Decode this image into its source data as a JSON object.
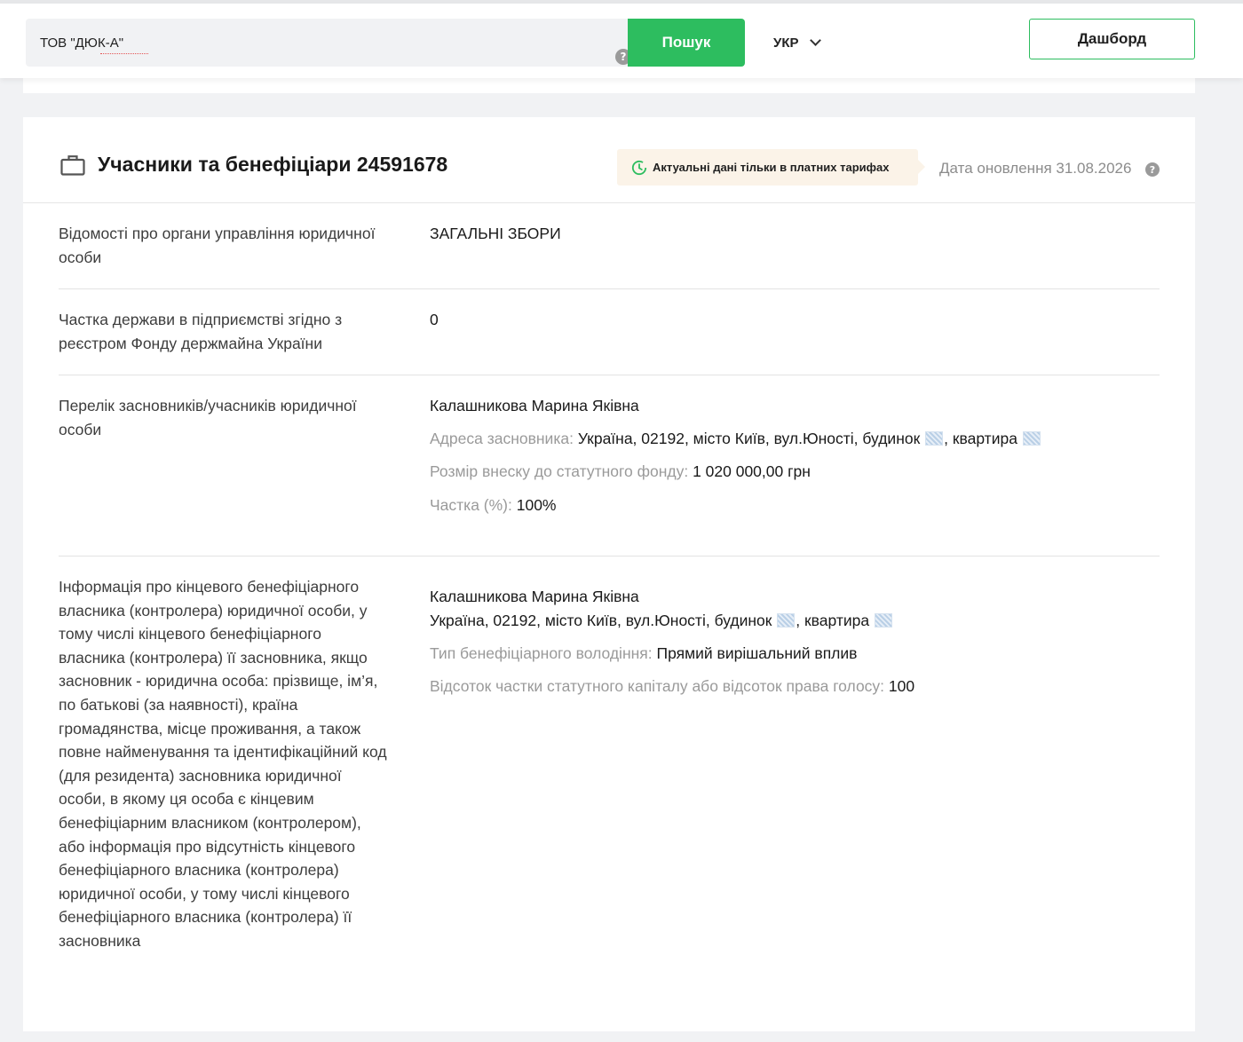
{
  "header": {
    "search_value": "ТОВ \"ДЮК-А\"",
    "search_button": "Пошук",
    "language": "УКР",
    "dashboard_button": "Дашборд",
    "help_glyph": "?"
  },
  "section": {
    "title": "Учасники та бенефіціари 24591678",
    "notice": "Актуальні дані тільки в платних тарифах",
    "updated": "Дата оновлення 31.08.2026",
    "rows": [
      {
        "label": "Відомості про органи управління юридичної особи",
        "value": "ЗАГАЛЬНІ ЗБОРИ"
      },
      {
        "label": "Частка держави в підприємстві згідно з реєстром Фонду держмайна України",
        "value": "0"
      },
      {
        "label": "Перелік засновників/учасників юридичної особи",
        "name": "Калашникова Марина Яківна",
        "address_label": "Адреса засновника:",
        "address_value": " Україна, 02192, місто Київ, вул.Юності, будинок ",
        "address_sep": ", квартира ",
        "contribution_label": "Розмір внеску до статутного фонду:",
        "contribution_value": " 1 020 000,00 грн",
        "share_label": "Частка (%):",
        "share_value": " 100%"
      },
      {
        "label": "Інформація про кінцевого бенефіціарного власника (контролера) юридичної особи, у тому числі кінцевого бенефіціарного власника (контролера) її засновника, якщо засновник - юридична особа: прізвище, ім’я, по батькові (за наявності), країна громадянства, місце проживання, а також повне найменування та ідентифікаційний код (для резидента) засновника юридичної особи, в якому ця особа є кінцевим бенефіціарним власником (контролером), або інформація про відсутність кінцевого бенефіціарного власника (контролера) юридичної особи, у тому числі кінцевого бенефіціарного власника (контролера) її засновника",
        "name": "Калашникова Марина Яківна",
        "address_value": "Україна, 02192, місто Київ, вул.Юності, будинок ",
        "address_sep": ", квартира ",
        "type_label": "Тип бенефіціарного володіння:",
        "type_value": " Прямий вирішальний вплив",
        "percent_label": "Відсоток частки статутного капіталу або відсоток права голосу:",
        "percent_value": " 100"
      }
    ]
  },
  "colors": {
    "accent_green": "#2dbd5f",
    "notice_bg": "#fbf3e8",
    "muted_text": "#9a9a9a"
  },
  "icons": [
    "help-icon",
    "chevron-down-icon",
    "briefcase-icon",
    "clock-icon"
  ]
}
